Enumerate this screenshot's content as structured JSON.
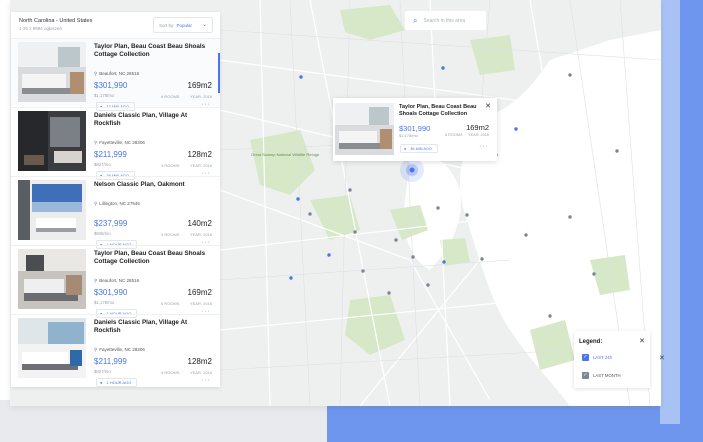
{
  "header": {
    "location": "North Carolina - United States",
    "subtitle": "1-20 z 9994 ogłoszeń",
    "sort_label": "Sort by:",
    "sort_value": "Popular"
  },
  "search": {
    "placeholder": "Search in this area",
    "icon": "search-icon"
  },
  "listings": [
    {
      "title": "Taylor Plan, Beau Coast Beau Shoals Cottage Collection",
      "address": "Beaufort, NC 28516",
      "price": "$301,990",
      "per_month": "$1,178/mo",
      "area": "169m2",
      "rooms": "6 ROOMS",
      "year": "YEAR: 2016",
      "badge": "12 MIN AGO"
    },
    {
      "title": "Daniels Classic Plan, Village At Rockfish",
      "address": "Fayetteville, NC 28306",
      "price": "$211,999",
      "per_month": "$827/mo",
      "area": "128m2",
      "rooms": "4 ROOMS",
      "year": "YEAR: 2016",
      "badge": "36 MIN AGO"
    },
    {
      "title": "Nelson Classic Plan, Oakmont",
      "address": "Lillington, NC 27546",
      "price": "$237,999",
      "per_month": "$928/mo",
      "area": "140m2",
      "rooms": "3 ROOMS",
      "year": "YEAR: 2016",
      "badge": "1 HOUR AGO"
    },
    {
      "title": "Taylor Plan, Beau Coast Beau Shoals Cottage Collection",
      "address": "Beaufort, NC 28516",
      "price": "$301,990",
      "per_month": "$1,178/mo",
      "area": "169m2",
      "rooms": "6 ROOMS",
      "year": "YEAR: 2016",
      "badge": "1 HOUR AGO"
    },
    {
      "title": "Daniels Classic Plan, Village At Rockfish",
      "address": "Fayetteville, NC 28306",
      "price": "$211,999",
      "per_month": "$827/mo",
      "area": "128m2",
      "rooms": "4 ROOMS",
      "year": "YEAR: 2016",
      "badge": "1 HOUR AGO"
    }
  ],
  "popup": {
    "title": "Taylor Plan, Beau Coast Beau Shoals Cottage Collection",
    "price": "$301,990",
    "per_month": "$1,178/mo",
    "area": "169m2",
    "rooms": "6 ROOMS",
    "year": "YEAR: 2016",
    "badge": "36 MIN AGO"
  },
  "legend": {
    "title": "Legend:",
    "items": [
      {
        "label": "LAST 24h",
        "color": "#4a76e8"
      },
      {
        "label": "LAST MONTH",
        "color": "#7d8794"
      }
    ]
  },
  "map_labels": [
    "Great Swamp National Wildlife Refuge"
  ],
  "colors": {
    "accent": "#4a76e8",
    "map_bg": "#eef0f0",
    "park": "#d6e8c8",
    "water": "#ffffff"
  }
}
